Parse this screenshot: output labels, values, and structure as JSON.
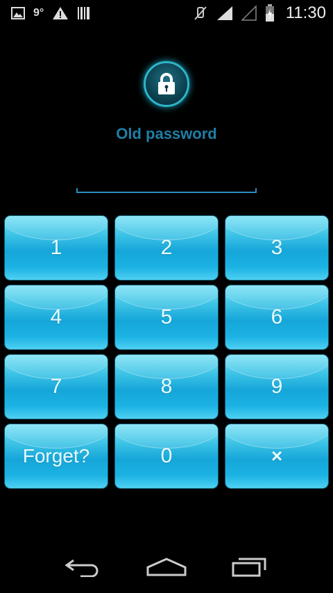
{
  "status_bar": {
    "temperature": "9°",
    "time": "11:30",
    "icons": [
      "gallery-icon",
      "warning-icon",
      "barcode-icon",
      "mute-icon",
      "signal-icon",
      "signal-empty-icon",
      "battery-icon"
    ]
  },
  "lock": {
    "icon": "padlock-icon",
    "prompt": "Old password",
    "accent": "#2fb5c9"
  },
  "keypad": {
    "keys": [
      "1",
      "2",
      "3",
      "4",
      "5",
      "6",
      "7",
      "8",
      "9",
      "Forget?",
      "0",
      "×"
    ],
    "key_color": "#16a6d9"
  },
  "nav": {
    "buttons": [
      "back-icon",
      "home-icon",
      "recents-icon"
    ]
  }
}
